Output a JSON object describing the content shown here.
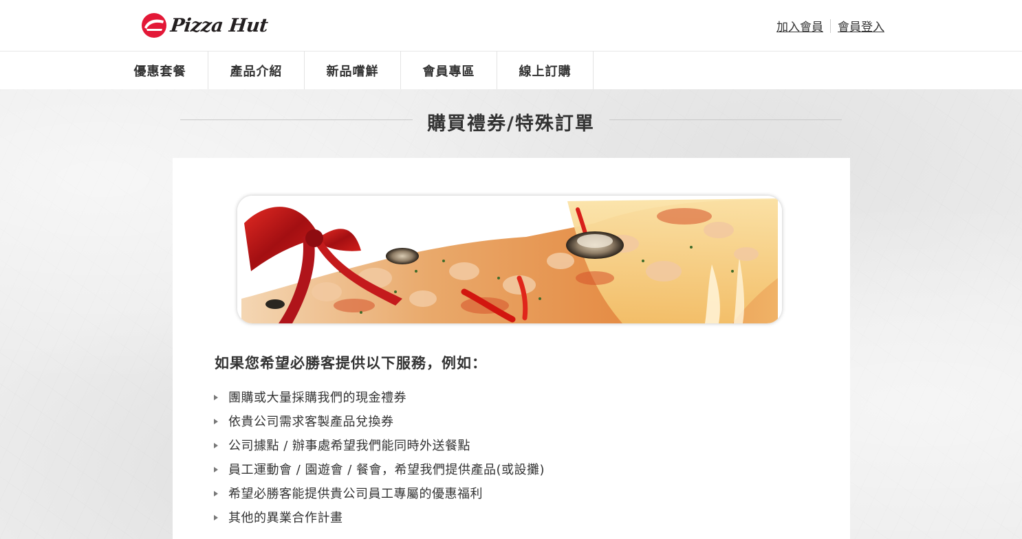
{
  "brand": {
    "name": "Pizza Hut",
    "color": "#e31837"
  },
  "header": {
    "links": [
      {
        "label": "加入會員"
      },
      {
        "label": "會員登入"
      }
    ]
  },
  "nav": {
    "items": [
      {
        "label": "優惠套餐"
      },
      {
        "label": "產品介紹"
      },
      {
        "label": "新品嚐鮮"
      },
      {
        "label": "會員專區"
      },
      {
        "label": "線上訂購"
      }
    ]
  },
  "page": {
    "title": "購買禮券/特殊訂單",
    "intro": "如果您希望必勝客提供以下服務，例如：",
    "services": [
      "團購或大量採購我們的現金禮券",
      "依貴公司需求客製產品兌換券",
      "公司據點 / 辦事處希望我們能同時外送餐點",
      "員工運動會 / 園遊會 / 餐會，希望我們提供產品(或設攤)",
      "希望必勝客能提供貴公司員工專屬的優惠福利",
      "其他的異業合作計畫"
    ]
  },
  "icons": {
    "logo": "pizza-hut-roof-logo-icon",
    "bullet": "triangle-bullet-icon",
    "banner": "gift-ribbon-pizza-banner-image"
  }
}
